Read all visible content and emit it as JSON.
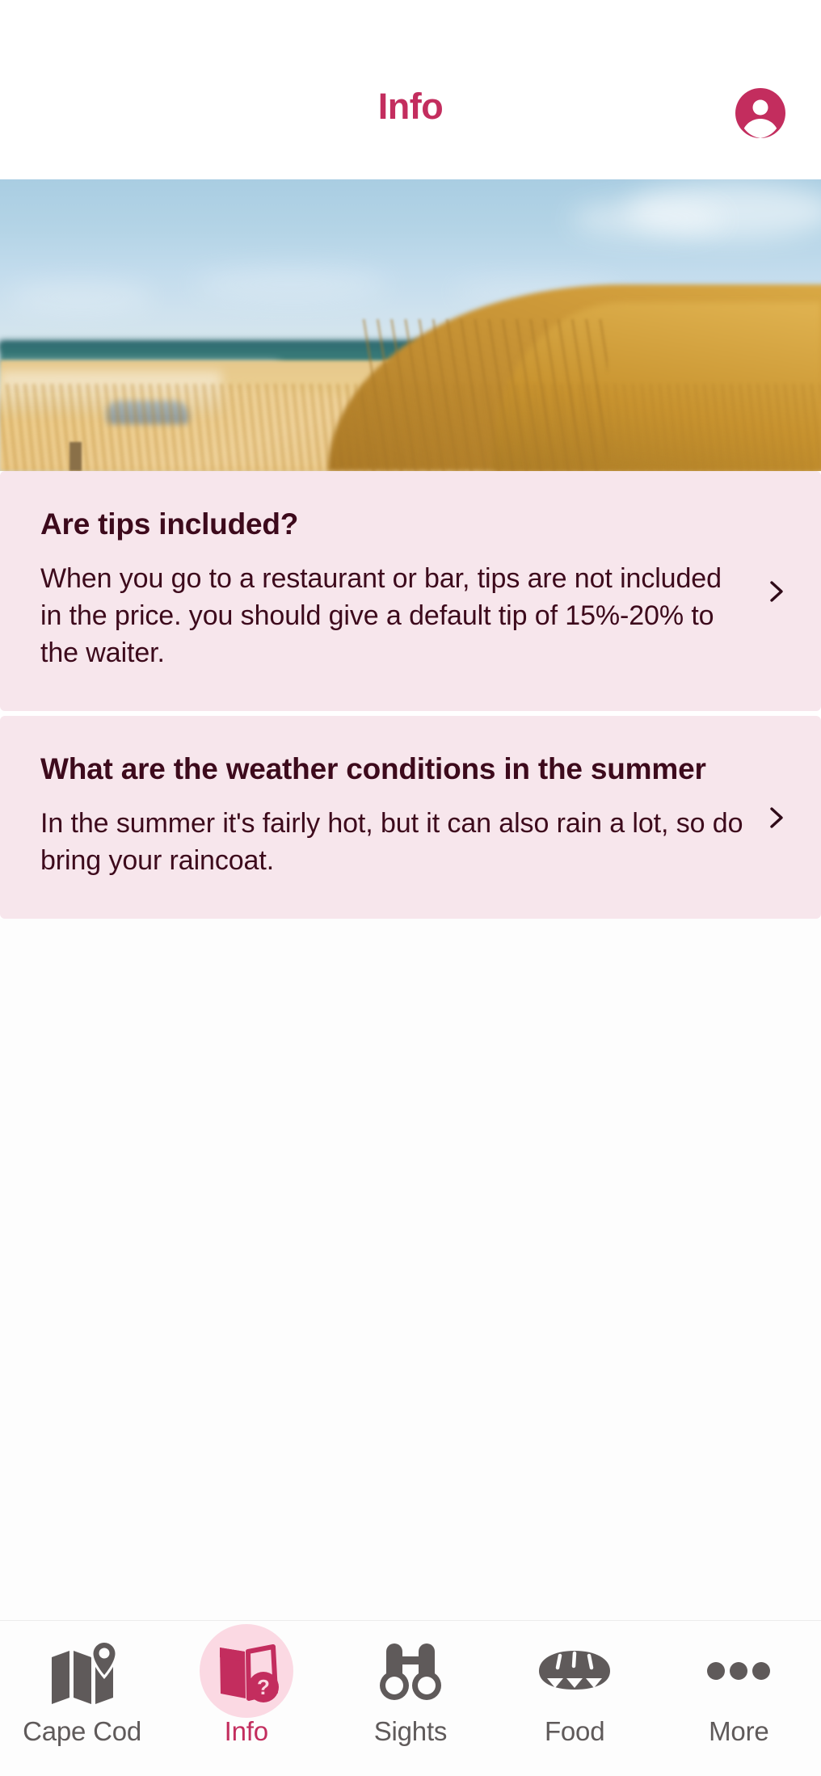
{
  "header": {
    "title": "Info",
    "avatar_icon": "account-circle-icon"
  },
  "hero": {
    "alt": "beach-dune-grass-photo"
  },
  "faq": {
    "items": [
      {
        "question": "Are tips included?",
        "answer": "When you go to a restaurant or bar, tips are not included in the price. you should give a default tip of 15%-20% to the waiter.",
        "chevron_icon": "chevron-right-icon"
      },
      {
        "question": "What are the weather conditions in the summer",
        "answer": "In the summer it's fairly hot, but it can also rain a lot, so do bring your raincoat.",
        "chevron_icon": "chevron-right-icon"
      }
    ]
  },
  "tabbar": {
    "items": [
      {
        "label": "Cape Cod",
        "icon": "map-pin-icon",
        "active": false
      },
      {
        "label": "Info",
        "icon": "info-booklet-question-icon",
        "active": true
      },
      {
        "label": "Sights",
        "icon": "binoculars-icon",
        "active": false
      },
      {
        "label": "Food",
        "icon": "bread-loaf-icon",
        "active": false
      },
      {
        "label": "More",
        "icon": "ellipsis-icon",
        "active": false
      }
    ]
  },
  "colors": {
    "accent": "#c32d5e",
    "accent_soft": "#fbd9e3",
    "card_bg": "#f7e6ec",
    "card_text": "#3d0a1c",
    "nav_inactive": "#5f5a5a",
    "page_bg": "#fdfdfd"
  }
}
